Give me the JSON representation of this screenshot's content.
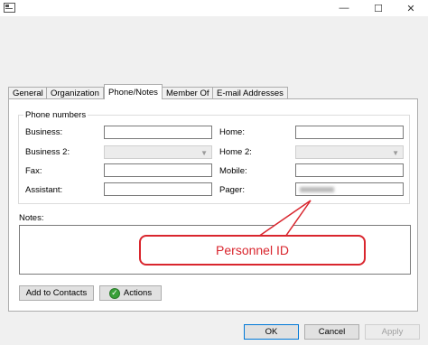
{
  "window": {
    "buttons": {
      "minimize": "—",
      "maximize": "☐",
      "close": "✕"
    }
  },
  "tabs": [
    {
      "label": "General"
    },
    {
      "label": "Organization"
    },
    {
      "label": "Phone/Notes",
      "active": true
    },
    {
      "label": "Member Of"
    },
    {
      "label": "E-mail Addresses"
    }
  ],
  "phone_numbers": {
    "title": "Phone numbers",
    "business": {
      "label": "Business:",
      "value": ""
    },
    "home": {
      "label": "Home:",
      "value": ""
    },
    "business2": {
      "label": "Business 2:",
      "value": ""
    },
    "home2": {
      "label": "Home 2:",
      "value": ""
    },
    "fax": {
      "label": "Fax:",
      "value": ""
    },
    "mobile": {
      "label": "Mobile:",
      "value": ""
    },
    "assistant": {
      "label": "Assistant:",
      "value": ""
    },
    "pager": {
      "label": "Pager:",
      "value": ""
    }
  },
  "notes": {
    "label": "Notes:",
    "value": ""
  },
  "buttons": {
    "add_to_contacts": "Add to Contacts",
    "actions": "Actions",
    "ok": "OK",
    "cancel": "Cancel",
    "apply": "Apply"
  },
  "callout": {
    "text": "Personnel ID"
  },
  "colors": {
    "callout": "#d9262e",
    "accent": "#0078d7"
  }
}
